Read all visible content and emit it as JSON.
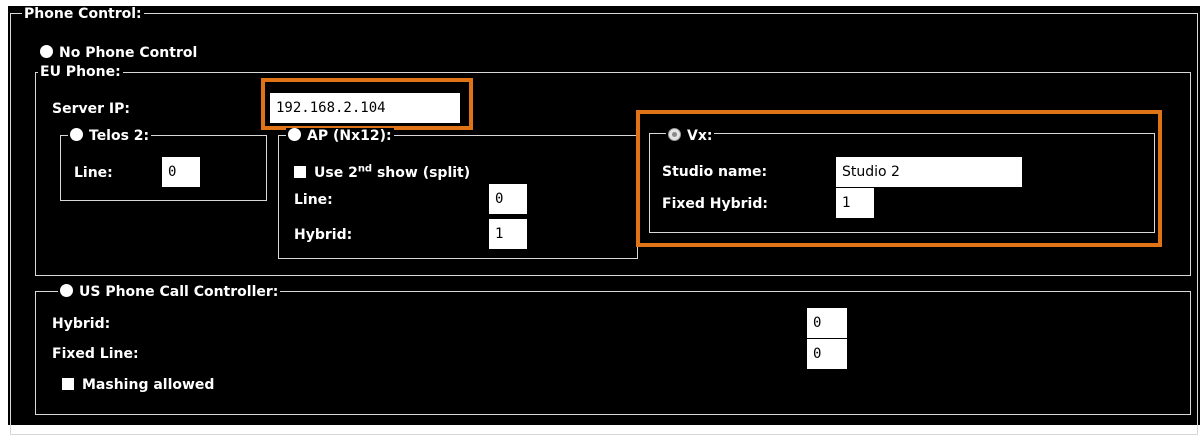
{
  "phone_control": {
    "legend": "Phone Control:",
    "no_phone_control_label": "No Phone Control",
    "eu_phone": {
      "legend": "EU Phone:",
      "server_ip_label": "Server IP:",
      "server_ip_value": "192.168.2.104",
      "telos2": {
        "legend": "Telos 2:",
        "line_label": "Line:",
        "line_value": "0"
      },
      "ap": {
        "legend": "AP (Nx12):",
        "use_prefix": "Use 2",
        "use_sup": "nd",
        "use_suffix": " show (split)",
        "line_label": "Line:",
        "line_value": "0",
        "hybrid_label": "Hybrid:",
        "hybrid_value": "1"
      },
      "vx": {
        "legend": "Vx:",
        "studio_name_label": "Studio name:",
        "studio_name_value": "Studio 2",
        "fixed_hybrid_label": "Fixed Hybrid:",
        "fixed_hybrid_value": "1"
      }
    },
    "us_phone": {
      "legend": "US Phone Call Controller:",
      "hybrid_label": "Hybrid:",
      "hybrid_value": "0",
      "fixed_line_label": "Fixed Line:",
      "fixed_line_value": "0",
      "mashing_label": "Mashing allowed"
    }
  },
  "colors": {
    "background": "#000000",
    "text": "#ffffff",
    "border": "#d8d8d8",
    "highlight": "#e07316"
  }
}
